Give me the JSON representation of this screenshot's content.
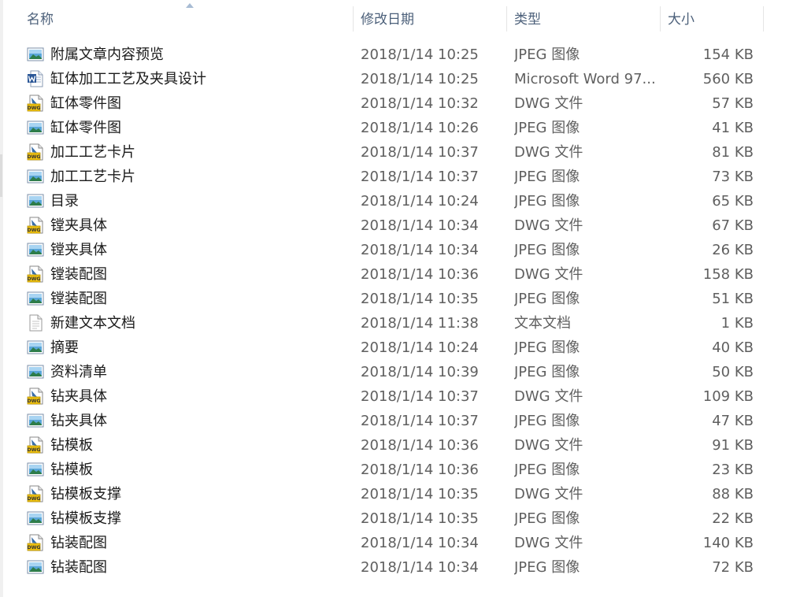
{
  "header": {
    "name_label": "名称",
    "date_label": "修改日期",
    "type_label": "类型",
    "size_label": "大小"
  },
  "files": [
    {
      "name": "附属文章内容预览",
      "date": "2018/1/14 10:25",
      "type": "JPEG 图像",
      "size": "154 KB",
      "icon": "jpeg-image-icon"
    },
    {
      "name": "缸体加工工艺及夹具设计",
      "date": "2018/1/14 10:25",
      "type": "Microsoft Word 97...",
      "size": "560 KB",
      "icon": "word-document-icon"
    },
    {
      "name": "缸体零件图",
      "date": "2018/1/14 10:32",
      "type": "DWG 文件",
      "size": "57 KB",
      "icon": "dwg-file-icon"
    },
    {
      "name": "缸体零件图",
      "date": "2018/1/14 10:26",
      "type": "JPEG 图像",
      "size": "41 KB",
      "icon": "jpeg-image-icon"
    },
    {
      "name": "加工工艺卡片",
      "date": "2018/1/14 10:37",
      "type": "DWG 文件",
      "size": "81 KB",
      "icon": "dwg-file-icon"
    },
    {
      "name": "加工工艺卡片",
      "date": "2018/1/14 10:37",
      "type": "JPEG 图像",
      "size": "73 KB",
      "icon": "jpeg-image-icon"
    },
    {
      "name": "目录",
      "date": "2018/1/14 10:24",
      "type": "JPEG 图像",
      "size": "65 KB",
      "icon": "jpeg-image-icon"
    },
    {
      "name": "镗夹具体",
      "date": "2018/1/14 10:34",
      "type": "DWG 文件",
      "size": "67 KB",
      "icon": "dwg-file-icon"
    },
    {
      "name": "镗夹具体",
      "date": "2018/1/14 10:34",
      "type": "JPEG 图像",
      "size": "26 KB",
      "icon": "jpeg-image-icon"
    },
    {
      "name": "镗装配图",
      "date": "2018/1/14 10:36",
      "type": "DWG 文件",
      "size": "158 KB",
      "icon": "dwg-file-icon"
    },
    {
      "name": "镗装配图",
      "date": "2018/1/14 10:35",
      "type": "JPEG 图像",
      "size": "51 KB",
      "icon": "jpeg-image-icon"
    },
    {
      "name": "新建文本文档",
      "date": "2018/1/14 11:38",
      "type": "文本文档",
      "size": "1 KB",
      "icon": "text-document-icon"
    },
    {
      "name": "摘要",
      "date": "2018/1/14 10:24",
      "type": "JPEG 图像",
      "size": "40 KB",
      "icon": "jpeg-image-icon"
    },
    {
      "name": "资料清单",
      "date": "2018/1/14 10:39",
      "type": "JPEG 图像",
      "size": "50 KB",
      "icon": "jpeg-image-icon"
    },
    {
      "name": "钻夹具体",
      "date": "2018/1/14 10:37",
      "type": "DWG 文件",
      "size": "109 KB",
      "icon": "dwg-file-icon"
    },
    {
      "name": "钻夹具体",
      "date": "2018/1/14 10:37",
      "type": "JPEG 图像",
      "size": "47 KB",
      "icon": "jpeg-image-icon"
    },
    {
      "name": "钻模板",
      "date": "2018/1/14 10:36",
      "type": "DWG 文件",
      "size": "91 KB",
      "icon": "dwg-file-icon"
    },
    {
      "name": "钻模板",
      "date": "2018/1/14 10:36",
      "type": "JPEG 图像",
      "size": "23 KB",
      "icon": "jpeg-image-icon"
    },
    {
      "name": "钻模板支撑",
      "date": "2018/1/14 10:35",
      "type": "DWG 文件",
      "size": "88 KB",
      "icon": "dwg-file-icon"
    },
    {
      "name": "钻模板支撑",
      "date": "2018/1/14 10:35",
      "type": "JPEG 图像",
      "size": "22 KB",
      "icon": "jpeg-image-icon"
    },
    {
      "name": "钻装配图",
      "date": "2018/1/14 10:34",
      "type": "DWG 文件",
      "size": "140 KB",
      "icon": "dwg-file-icon"
    },
    {
      "name": "钻装配图",
      "date": "2018/1/14 10:34",
      "type": "JPEG 图像",
      "size": "72 KB",
      "icon": "jpeg-image-icon"
    }
  ]
}
